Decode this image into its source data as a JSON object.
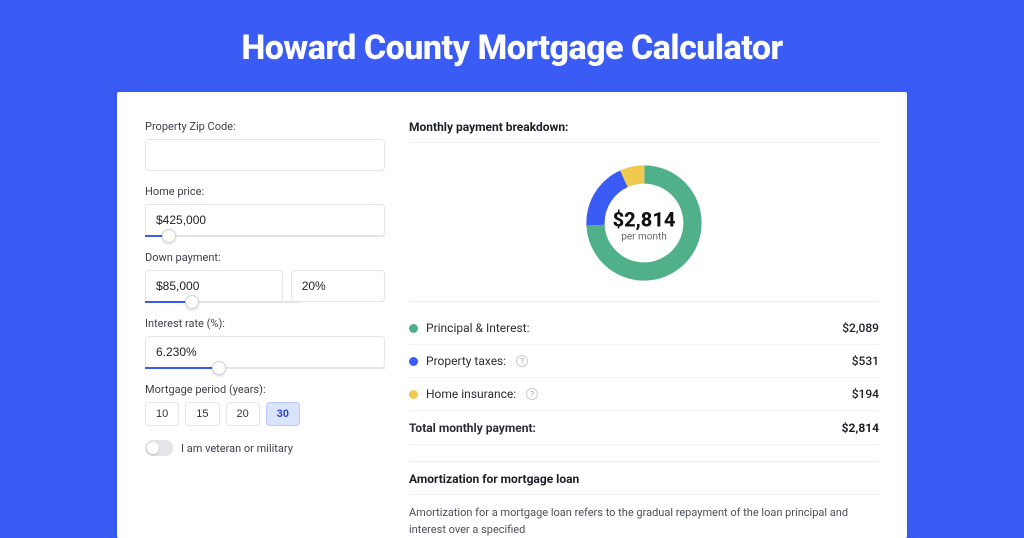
{
  "title": "Howard County Mortgage Calculator",
  "form": {
    "zip_label": "Property Zip Code:",
    "zip_value": "",
    "home_price_label": "Home price:",
    "home_price_value": "$425,000",
    "down_payment_label": "Down payment:",
    "down_payment_value": "$85,000",
    "down_payment_pct": "20%",
    "interest_label": "Interest rate (%):",
    "interest_value": "6.230%",
    "period_label": "Mortgage period (years):",
    "periods": [
      "10",
      "15",
      "20",
      "30"
    ],
    "period_active_index": 3,
    "veteran_label": "I am veteran or military"
  },
  "breakdown": {
    "title": "Monthly payment breakdown:",
    "donut_amount": "$2,814",
    "donut_sub": "per month",
    "rows": [
      {
        "label": "Principal & Interest:",
        "value": "$2,089",
        "has_info": false
      },
      {
        "label": "Property taxes:",
        "value": "$531",
        "has_info": true
      },
      {
        "label": "Home insurance:",
        "value": "$194",
        "has_info": true
      }
    ],
    "total_label": "Total monthly payment:",
    "total_value": "$2,814"
  },
  "chart_data": {
    "type": "pie",
    "title": "Monthly payment breakdown",
    "series": [
      {
        "name": "Principal & Interest",
        "value": 2089,
        "color": "#4fb08a"
      },
      {
        "name": "Property taxes",
        "value": 531,
        "color": "#3a5cf5"
      },
      {
        "name": "Home insurance",
        "value": 194,
        "color": "#f0c94f"
      }
    ],
    "total": 2814
  },
  "amortization": {
    "title": "Amortization for mortgage loan",
    "body": "Amortization for a mortgage loan refers to the gradual repayment of the loan principal and interest over a specified"
  }
}
